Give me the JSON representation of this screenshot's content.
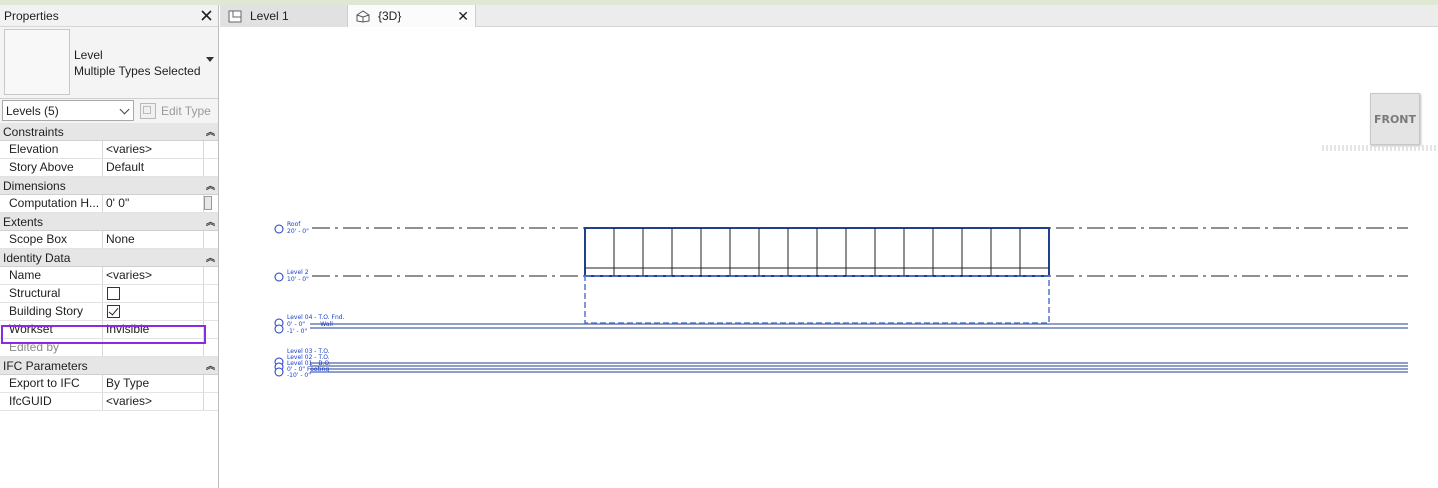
{
  "properties": {
    "title": "Properties",
    "type_name": "Level",
    "type_desc": "Multiple Types Selected",
    "filter": "Levels (5)",
    "edit_type": "Edit Type",
    "groups": {
      "constraints": "Constraints",
      "dimensions": "Dimensions",
      "extents": "Extents",
      "identity": "Identity Data",
      "ifc": "IFC Parameters"
    },
    "params": {
      "elevation": {
        "k": "Elevation",
        "v": "<varies>"
      },
      "story_above": {
        "k": "Story Above",
        "v": "Default"
      },
      "computation": {
        "k": "Computation H...",
        "v": "0'  0\""
      },
      "scope_box": {
        "k": "Scope Box",
        "v": "None"
      },
      "name": {
        "k": "Name",
        "v": "<varies>"
      },
      "structural": {
        "k": "Structural",
        "checked": false
      },
      "building_story": {
        "k": "Building Story",
        "checked": true
      },
      "workset": {
        "k": "Workset",
        "v": "Invisible"
      },
      "edited_by": {
        "k": "Edited by",
        "v": ""
      },
      "export_ifc": {
        "k": "Export to IFC",
        "v": "By Type"
      },
      "ifcguid": {
        "k": "IfcGUID",
        "v": "<varies>"
      }
    }
  },
  "tabs": [
    {
      "label": "Level 1",
      "icon": "floor-plan-icon",
      "active": false
    },
    {
      "label": "{3D}",
      "icon": "3d-house-icon",
      "active": true
    }
  ],
  "viewcube": {
    "face": "FRONT"
  },
  "levels": {
    "roof": {
      "name": "Roof",
      "elev": "20' - 0\""
    },
    "level2": {
      "name": "Level 2",
      "elev": "10' - 0\""
    },
    "level04": {
      "name": "Level 04 - T.O. Fnd.",
      "elev_a": "0' - 0\"",
      "elev_b": "-1' - 0\"",
      "tail": "Wall"
    },
    "level03": {
      "name": "Level 03 - T.O.",
      "name2": "Level 02 - T.O.",
      "name3": "Level 01 - B.O.",
      "elev": "0' - 0\"",
      "tail": "Footing",
      "elev_b": "-10' - 0\""
    }
  },
  "colors": {
    "accent": "#8a2be2",
    "level_blue": "#1a3cc8",
    "wall_blue": "#1f3f8f"
  }
}
